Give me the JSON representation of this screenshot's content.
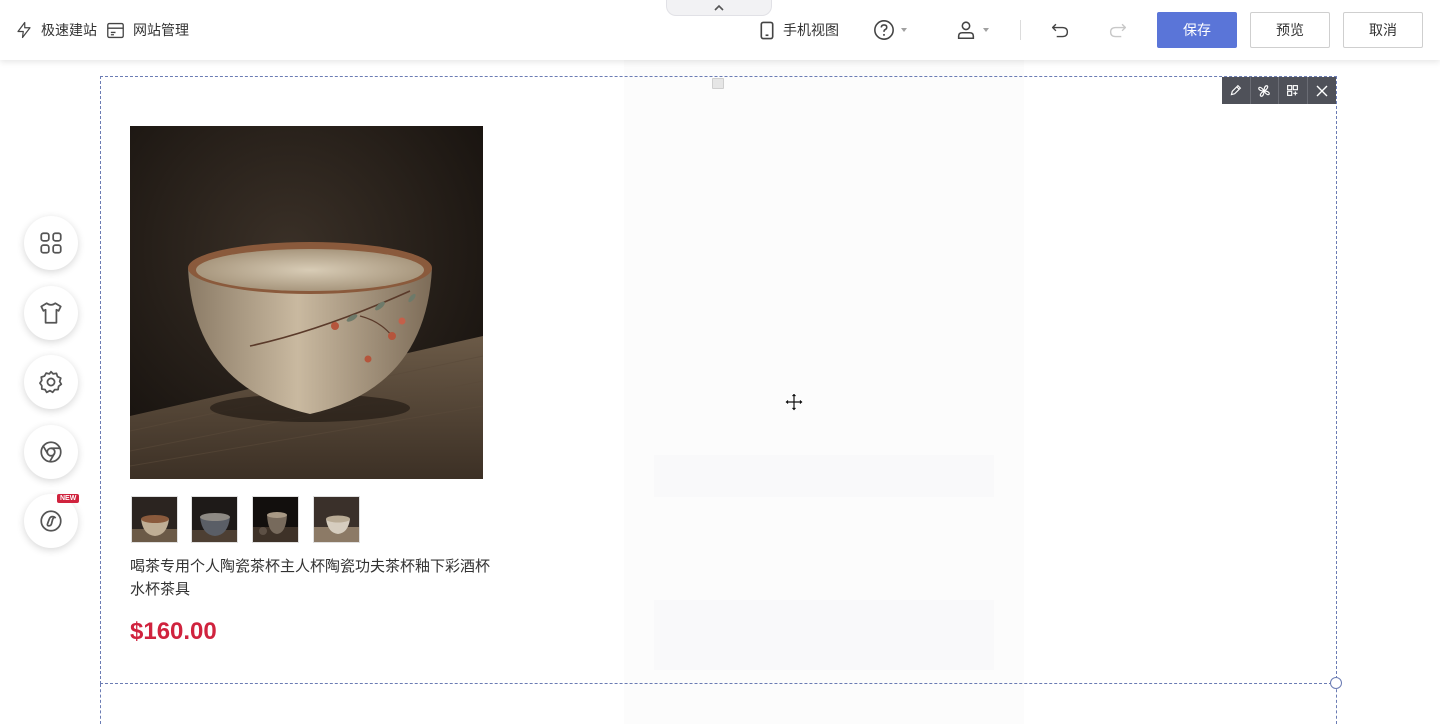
{
  "toolbar": {
    "quick_build": "极速建站",
    "site_manage": "网站管理",
    "mobile_view": "手机视图",
    "save": "保存",
    "preview": "预览",
    "cancel": "取消"
  },
  "product": {
    "title": "喝茶专用个人陶瓷茶杯主人杯陶瓷功夫茶杯釉下彩酒杯水杯茶具",
    "price": "$160.00",
    "thumbnail_count": 4
  },
  "side_toolbar": {
    "items": [
      "apps-icon",
      "tshirt-icon",
      "settings-icon",
      "chrome-icon",
      "link-icon"
    ],
    "badge": "NEW"
  },
  "colors": {
    "primary": "#5a75d8",
    "price": "#d0233e",
    "selection_border": "#6b7cb4",
    "module_tools_bg": "#4f5159"
  }
}
